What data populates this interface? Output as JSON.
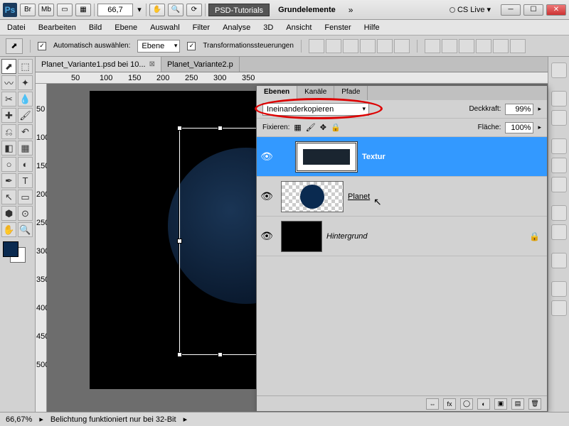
{
  "titlebar": {
    "zoom": "66,7",
    "psd_tut": "PSD-Tutorials",
    "grundelemente": "Grundelemente",
    "cslive": "CS Live",
    "br": "Br",
    "mb": "Mb"
  },
  "menu": [
    "Datei",
    "Bearbeiten",
    "Bild",
    "Ebene",
    "Auswahl",
    "Filter",
    "Analyse",
    "3D",
    "Ansicht",
    "Fenster",
    "Hilfe"
  ],
  "optbar": {
    "auto_select": "Automatisch auswählen:",
    "auto_target": "Ebene",
    "transform_ctrl": "Transformationssteuerungen"
  },
  "tabs": [
    {
      "label": "Planet_Variante1.psd bei 10...",
      "active": true
    },
    {
      "label": "Planet_Variante2.p",
      "active": false
    }
  ],
  "ruler_h": [
    "50",
    "100",
    "150",
    "200",
    "250",
    "300",
    "350"
  ],
  "ruler_v": [
    "50",
    "100",
    "150",
    "200",
    "250",
    "300",
    "350",
    "400",
    "450",
    "500"
  ],
  "panel": {
    "tabs": [
      "Ebenen",
      "Kanäle",
      "Pfade"
    ],
    "blend_mode": "Ineinanderkopieren",
    "opacity_label": "Deckkraft:",
    "opacity": "99%",
    "lock_label": "Fixieren:",
    "fill_label": "Fläche:",
    "fill": "100%",
    "layers": [
      {
        "name": "Textur",
        "selected": true,
        "eye": true
      },
      {
        "name": "Planet",
        "selected": false,
        "eye": true
      },
      {
        "name": "Hintergrund",
        "selected": false,
        "eye": true,
        "locked": true
      }
    ],
    "foot_fx": "fx"
  },
  "status": {
    "zoom": "66,67%",
    "msg": "Belichtung funktioniert nur bei 32-Bit"
  }
}
